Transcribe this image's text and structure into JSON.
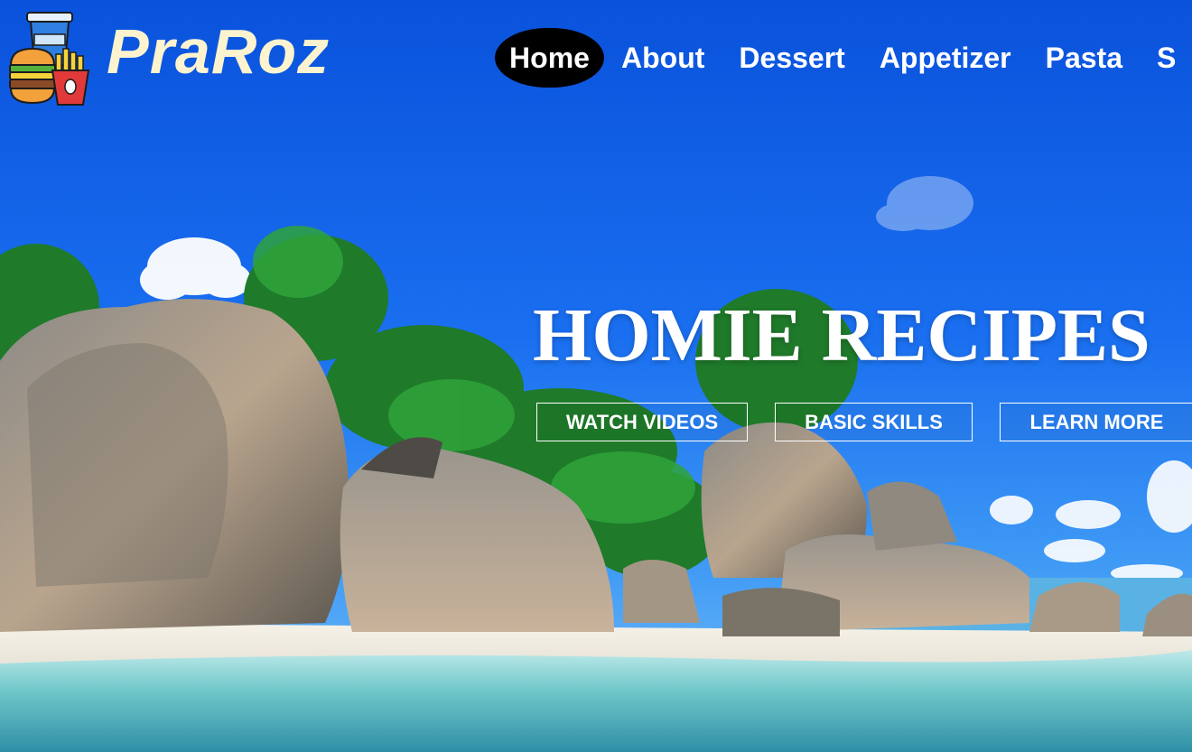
{
  "brand": {
    "name": "PraRoz",
    "logo_icon": "burger-fries-drink-icon"
  },
  "nav": {
    "items": [
      {
        "label": "Home",
        "active": true
      },
      {
        "label": "About"
      },
      {
        "label": "Dessert"
      },
      {
        "label": "Appetizer"
      },
      {
        "label": "Pasta"
      },
      {
        "label": "S"
      }
    ]
  },
  "hero": {
    "title": "HOMIE RECIPES",
    "buttons": [
      {
        "label": "WATCH VIDEOS"
      },
      {
        "label": "BASIC SKILLS"
      },
      {
        "label": "LEARN MORE"
      }
    ],
    "background": "tropical-beach-granite-rocks-photo"
  },
  "colors": {
    "sky": "#1560e0",
    "brand_text": "#fdf3cf",
    "nav_active_bg": "#000000",
    "text": "#ffffff"
  }
}
